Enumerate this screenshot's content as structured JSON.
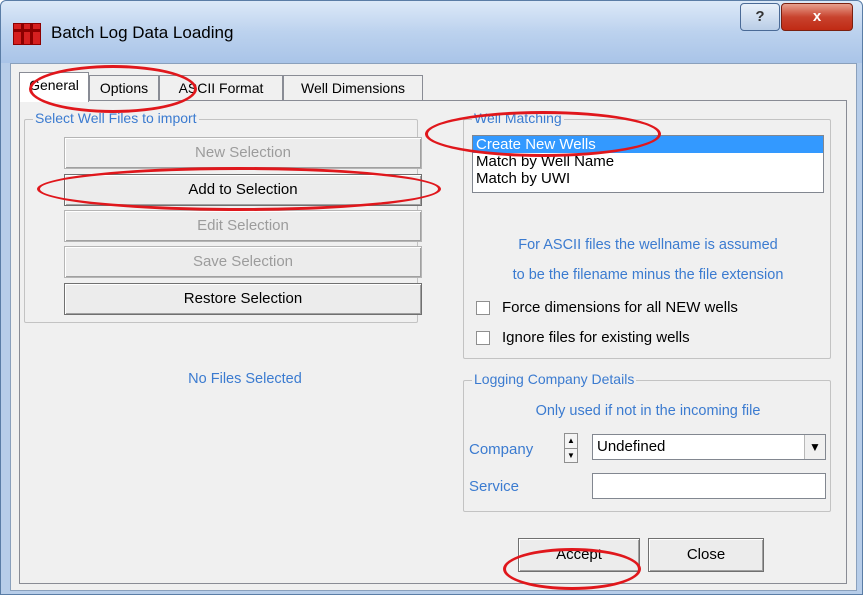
{
  "window": {
    "title": "Batch Log Data Loading",
    "help_label": "?",
    "close_label": "x",
    "icon": "batch-log-app-icon"
  },
  "tabs": [
    {
      "label": "General",
      "active": true
    },
    {
      "label": "Options",
      "active": false
    },
    {
      "label": "ASCII Format",
      "active": false
    },
    {
      "label": "Well Dimensions",
      "active": false
    }
  ],
  "select_files": {
    "legend": "Select Well Files to import",
    "buttons": [
      {
        "label": "New Selection",
        "enabled": false
      },
      {
        "label": "Add to Selection",
        "enabled": true
      },
      {
        "label": "Edit Selection",
        "enabled": false
      },
      {
        "label": "Save Selection",
        "enabled": false
      },
      {
        "label": "Restore Selection",
        "enabled": true
      }
    ],
    "status": "No Files Selected"
  },
  "well_matching": {
    "legend": "Well Matching",
    "options": [
      "Create New Wells",
      "Match by Well Name",
      "Match by UWI"
    ],
    "selected": "Create New Wells",
    "info_line1": "For ASCII files the wellname is assumed",
    "info_line2": "to be the filename minus the file extension",
    "force_dimensions_label": "Force dimensions for all NEW wells",
    "force_dimensions_checked": false,
    "ignore_existing_label": "Ignore files for existing wells",
    "ignore_existing_checked": false
  },
  "logging_company": {
    "legend": "Logging Company Details",
    "note": "Only used if not in the incoming file",
    "company_label": "Company",
    "company_value": "Undefined",
    "service_label": "Service",
    "service_value": ""
  },
  "footer": {
    "accept_label": "Accept",
    "close_label": "Close"
  },
  "colors": {
    "annotation": "#e0171c",
    "label_blue": "#3b7bd0",
    "selection": "#3399ff"
  }
}
